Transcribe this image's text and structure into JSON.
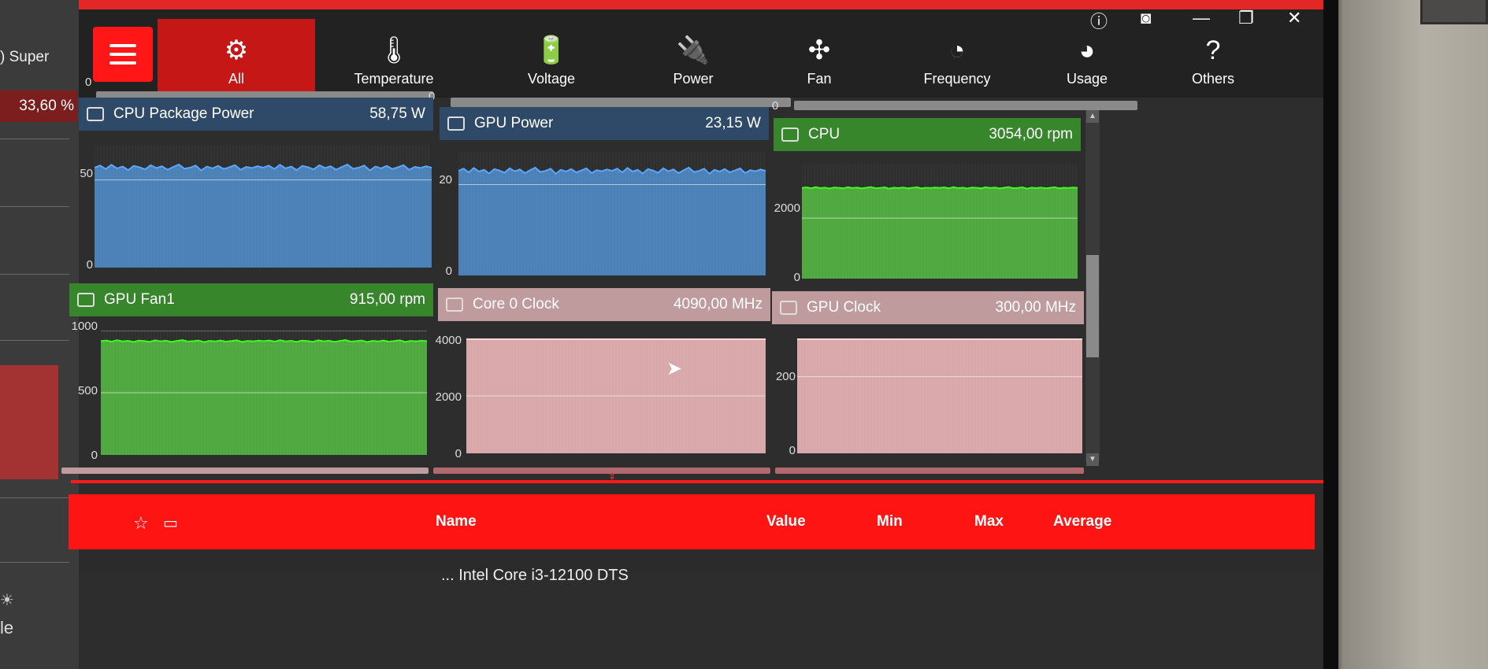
{
  "background_window": {
    "partial_title": ") Super",
    "percent": "33,60 %",
    "bottom_label": "le",
    "bottom_glyph": "☀"
  },
  "nav": {
    "tabs": [
      {
        "label": "All",
        "icon": "wrench-gauge-icon",
        "active": true
      },
      {
        "label": "Temperature",
        "icon": "thermometer-water-icon",
        "active": false
      },
      {
        "label": "Voltage",
        "icon": "battery-bolt-icon",
        "active": false
      },
      {
        "label": "Power",
        "icon": "plug-icon",
        "active": false
      },
      {
        "label": "Fan",
        "icon": "fan-icon",
        "active": false
      },
      {
        "label": "Frequency",
        "icon": "speedometer-icon",
        "active": false
      },
      {
        "label": "Usage",
        "icon": "dial-icon",
        "active": false
      },
      {
        "label": "Others",
        "icon": "question-circle-icon",
        "active": false
      }
    ],
    "window_controls": [
      "info-icon",
      "camera-icon",
      "minimize-icon",
      "restore-icon",
      "close-icon"
    ]
  },
  "top_zero_labels": [
    "0",
    "0",
    "0"
  ],
  "graphs": [
    {
      "name": "CPU Package Power",
      "value": "58,75 W",
      "color": "blue",
      "ymax": 70,
      "yticks": [
        "50",
        "0"
      ],
      "level": 57
    },
    {
      "name": "GPU Power",
      "value": "23,15 W",
      "color": "blue",
      "ymax": 27,
      "yticks": [
        "20",
        "0"
      ],
      "level": 23
    },
    {
      "name": "CPU",
      "value": "3054,00 rpm",
      "color": "green",
      "ymax": 3800,
      "yticks": [
        "2000",
        "0"
      ],
      "level": 3000
    },
    {
      "name": "GPU Fan1",
      "value": "915,00 rpm",
      "color": "green",
      "ymax": 1000,
      "yticks": [
        "1000",
        "500",
        "0"
      ],
      "level": 915
    },
    {
      "name": "Core 0 Clock",
      "value": "4090,00 MHz",
      "color": "pink",
      "ymax": 4000,
      "yticks": [
        "4000",
        "2000",
        "0"
      ],
      "level": 4000
    },
    {
      "name": "GPU Clock",
      "value": "300,00 MHz",
      "color": "pink",
      "ymax": 300,
      "yticks": [
        "200",
        "0"
      ],
      "level": 300
    }
  ],
  "colors": {
    "blue_header": "#2f4a68",
    "blue_fill": "#4a80b6",
    "blue_line": "#5aa7ff",
    "green_header": "#37862c",
    "green_fill": "#4fa83e",
    "green_line": "#3cff1e",
    "pink_header": "#c09b9d",
    "pink_fill": "#d7a7aa",
    "pink_line": "#ffd7d9",
    "accent_red": "#ff1414"
  },
  "table": {
    "columns": {
      "name": "Name",
      "value": "Value",
      "min": "Min",
      "max": "Max",
      "average": "Average"
    },
    "first_row_partial": "... Intel Core i3-12100 DTS"
  }
}
